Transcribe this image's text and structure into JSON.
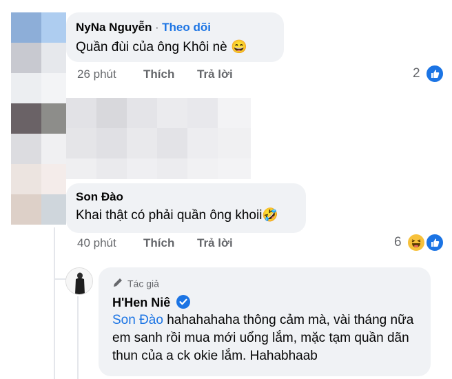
{
  "comments": [
    {
      "author": "NyNa Nguyễn",
      "separator": "·",
      "follow_label": "Theo dõi",
      "text": "Quần đùi của ông Khôi nè 😄",
      "time": "26 phút",
      "like_label": "Thích",
      "reply_label": "Trả lời",
      "reaction_count": "2",
      "reactions": [
        "like-icon"
      ]
    },
    {
      "author": "Son Đào",
      "text": "Khai thật có phải quần ông khoii🤣",
      "time": "40 phút",
      "like_label": "Thích",
      "reply_label": "Trả lời",
      "reaction_count": "6",
      "reactions": [
        "haha-icon",
        "like-icon"
      ]
    }
  ],
  "reply": {
    "author_tag": "Tác giả",
    "author": "H'Hen Niê",
    "verified": true,
    "mention": "Son Đào",
    "text": " hahahahaha thông cảm mà, vài tháng nữa em sanh rồi mua mới uổng lắm, mặc tạm quần dãn thun của a ck okie lắm. Hahabhaab"
  },
  "colors": {
    "accent": "#1b74e4",
    "bubble": "#f0f2f5",
    "meta": "#65676b"
  }
}
